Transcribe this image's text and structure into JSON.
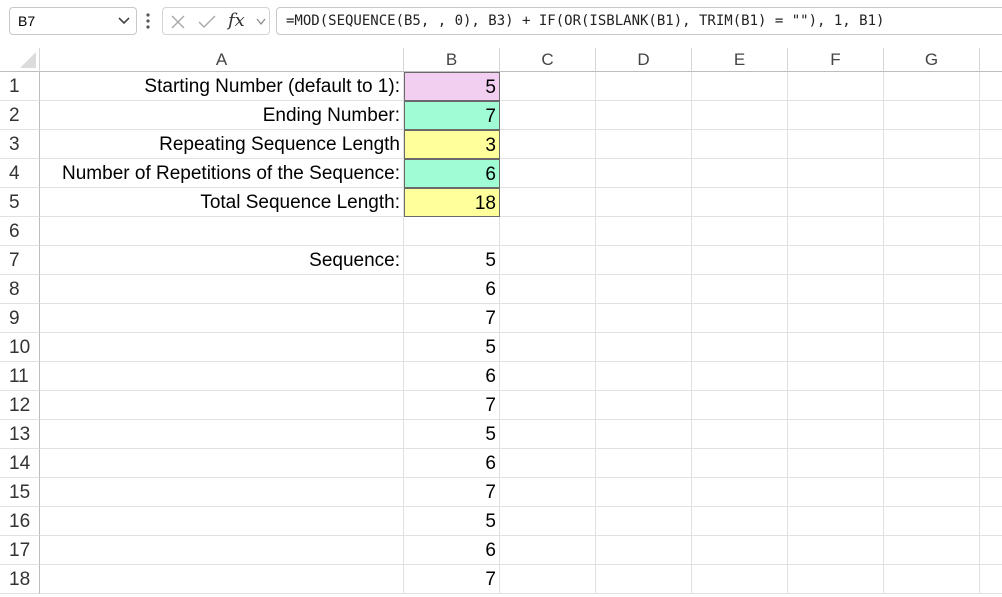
{
  "name_box": {
    "value": "B7"
  },
  "formula_bar": {
    "fx_label": "fx",
    "formula": "=MOD(SEQUENCE(B5, , 0), B3) + IF(OR(ISBLANK(B1), TRIM(B1) = \"\"), 1, B1)"
  },
  "columns": [
    "A",
    "B",
    "C",
    "D",
    "E",
    "F",
    "G"
  ],
  "rows": [
    "1",
    "2",
    "3",
    "4",
    "5",
    "6",
    "7",
    "8",
    "9",
    "10",
    "11",
    "12",
    "13",
    "14",
    "15",
    "16",
    "17",
    "18"
  ],
  "cells": {
    "A1": "Starting Number (default to 1):",
    "A2": "Ending Number:",
    "A3": "Repeating Sequence Length",
    "A4": "Number of Repetitions of the Sequence:",
    "A5": "Total Sequence Length:",
    "A7": "Sequence:",
    "B1": "5",
    "B2": "7",
    "B3": "3",
    "B4": "6",
    "B5": "18",
    "B7": "5",
    "B8": "6",
    "B9": "7",
    "B10": "5",
    "B11": "6",
    "B12": "7",
    "B13": "5",
    "B14": "6",
    "B15": "7",
    "B16": "5",
    "B17": "6",
    "B18": "7"
  },
  "fill_colors": {
    "B1": "#f2cff0",
    "B2": "#9ffcd5",
    "B3": "#ffff9c",
    "B4": "#9ffcd5",
    "B5": "#ffff9c"
  }
}
